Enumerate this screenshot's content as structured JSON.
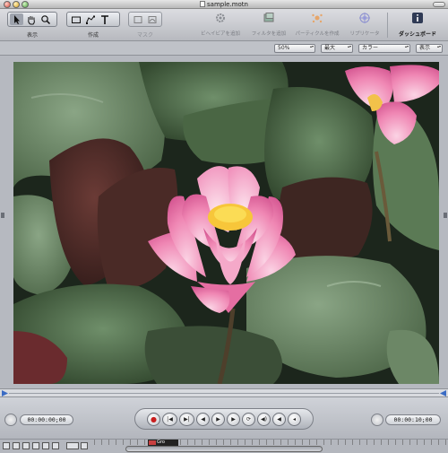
{
  "window": {
    "title": "sample.motn"
  },
  "toolbar": {
    "groups": [
      {
        "label": "表示",
        "tools": [
          "arrow-tool-icon",
          "hand-tool-icon",
          "zoom-tool-icon"
        ]
      },
      {
        "label": "作成",
        "tools": [
          "rectangle-tool-icon",
          "pen-tool-icon",
          "text-tool-icon"
        ]
      },
      {
        "label": "マスク",
        "tools": [
          "mask-rectangle-icon",
          "mask-bezier-icon"
        ]
      }
    ],
    "actions": [
      {
        "label": "ビヘイビアを追加",
        "icon": "gear-icon"
      },
      {
        "label": "フィルタを追加",
        "icon": "filter-icon"
      },
      {
        "label": "パーティクルを作成",
        "icon": "particle-icon"
      },
      {
        "label": "リプリケータ",
        "icon": "replicator-icon"
      }
    ],
    "dashboard_label": "ダッシュボード"
  },
  "canvas_controls": {
    "zoom": "50%",
    "resolution": "最大",
    "channel": "カラー",
    "view": "表示"
  },
  "transport": {
    "current_time": "00:00:00;00",
    "duration": "00:00:10;00"
  },
  "timeline": {
    "layer_label": "Gro"
  }
}
